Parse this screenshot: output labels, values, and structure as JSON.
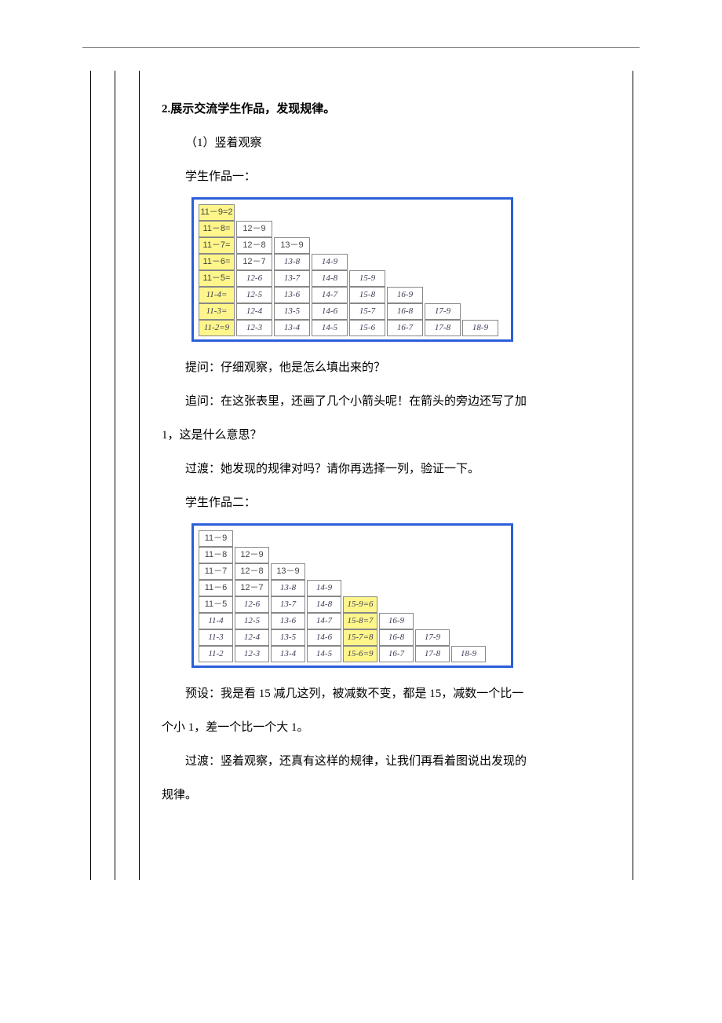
{
  "heading": "2.展示交流学生作品，发现规律。",
  "sub1": "（1）竖着观察",
  "work1_label": "学生作品一：",
  "q1": "提问：仔细观察，他是怎么填出来的？",
  "q2_a": "追问：在这张表里，还画了几个小箭头呢！在箭头的旁边还写了加",
  "q2_b": "1，这是什么意思？",
  "trans1": "过渡：她发现的规律对吗？请你再选择一列，验证一下。",
  "work2_label": "学生作品二：",
  "preset_a": "预设：我是看 15 减几这列，被减数不变，都是 15，减数一个比一",
  "preset_b": "个小 1，差一个比一个大 1。",
  "trans2_a": "过渡：竖着观察，还真有这样的规律，让我们再看着图说出发现的",
  "trans2_b": "规律。",
  "table1": {
    "rows": [
      [
        {
          "t": "11－9=2",
          "hl": 1
        }
      ],
      [
        {
          "t": "11－8=",
          "hl": 1
        },
        {
          "t": "12－9"
        }
      ],
      [
        {
          "t": "11－7=",
          "hl": 1
        },
        {
          "t": "12－8"
        },
        {
          "t": "13－9"
        }
      ],
      [
        {
          "t": "11－6=",
          "hl": 1
        },
        {
          "t": "12－7"
        },
        {
          "t": "13-8",
          "hw": 1
        },
        {
          "t": "14-9",
          "hw": 1
        }
      ],
      [
        {
          "t": "11－5=",
          "hl": 1
        },
        {
          "t": "12-6",
          "hw": 1
        },
        {
          "t": "13-7",
          "hw": 1
        },
        {
          "t": "14-8",
          "hw": 1
        },
        {
          "t": "15-9",
          "hw": 1
        }
      ],
      [
        {
          "t": "11-4=",
          "hl": 1,
          "hw": 1
        },
        {
          "t": "12-5",
          "hw": 1
        },
        {
          "t": "13-6",
          "hw": 1
        },
        {
          "t": "14-7",
          "hw": 1
        },
        {
          "t": "15-8",
          "hw": 1
        },
        {
          "t": "16-9",
          "hw": 1
        }
      ],
      [
        {
          "t": "11-3=",
          "hl": 1,
          "hw": 1
        },
        {
          "t": "12-4",
          "hw": 1
        },
        {
          "t": "13-5",
          "hw": 1
        },
        {
          "t": "14-6",
          "hw": 1
        },
        {
          "t": "15-7",
          "hw": 1
        },
        {
          "t": "16-8",
          "hw": 1
        },
        {
          "t": "17-9",
          "hw": 1
        }
      ],
      [
        {
          "t": "11-2=9",
          "hl": 1,
          "hw": 1
        },
        {
          "t": "12-3",
          "hw": 1
        },
        {
          "t": "13-4",
          "hw": 1
        },
        {
          "t": "14-5",
          "hw": 1
        },
        {
          "t": "15-6",
          "hw": 1
        },
        {
          "t": "16-7",
          "hw": 1
        },
        {
          "t": "17-8",
          "hw": 1
        },
        {
          "t": "18-9",
          "hw": 1
        }
      ]
    ]
  },
  "table2": {
    "rows": [
      [
        {
          "t": "11－9"
        }
      ],
      [
        {
          "t": "11－8"
        },
        {
          "t": "12－9"
        }
      ],
      [
        {
          "t": "11－7"
        },
        {
          "t": "12－8"
        },
        {
          "t": "13－9"
        }
      ],
      [
        {
          "t": "11－6"
        },
        {
          "t": "12－7"
        },
        {
          "t": "13-8",
          "hw": 1
        },
        {
          "t": "14-9",
          "hw": 1
        }
      ],
      [
        {
          "t": "11－5"
        },
        {
          "t": "12-6",
          "hw": 1
        },
        {
          "t": "13-7",
          "hw": 1
        },
        {
          "t": "14-8",
          "hw": 1
        },
        {
          "t": "15-9=6",
          "hw": 1,
          "hl": 1
        }
      ],
      [
        {
          "t": "11-4",
          "hw": 1
        },
        {
          "t": "12-5",
          "hw": 1
        },
        {
          "t": "13-6",
          "hw": 1
        },
        {
          "t": "14-7",
          "hw": 1
        },
        {
          "t": "15-8=7",
          "hw": 1,
          "hl": 1
        },
        {
          "t": "16-9",
          "hw": 1
        }
      ],
      [
        {
          "t": "11-3",
          "hw": 1
        },
        {
          "t": "12-4",
          "hw": 1
        },
        {
          "t": "13-5",
          "hw": 1
        },
        {
          "t": "14-6",
          "hw": 1
        },
        {
          "t": "15-7=8",
          "hw": 1,
          "hl": 1
        },
        {
          "t": "16-8",
          "hw": 1
        },
        {
          "t": "17-9",
          "hw": 1
        }
      ],
      [
        {
          "t": "11-2",
          "hw": 1
        },
        {
          "t": "12-3",
          "hw": 1
        },
        {
          "t": "13-4",
          "hw": 1
        },
        {
          "t": "14-5",
          "hw": 1
        },
        {
          "t": "15-6=9",
          "hw": 1,
          "hl": 1
        },
        {
          "t": "16-7",
          "hw": 1
        },
        {
          "t": "17-8",
          "hw": 1
        },
        {
          "t": "18-9",
          "hw": 1
        }
      ]
    ]
  }
}
